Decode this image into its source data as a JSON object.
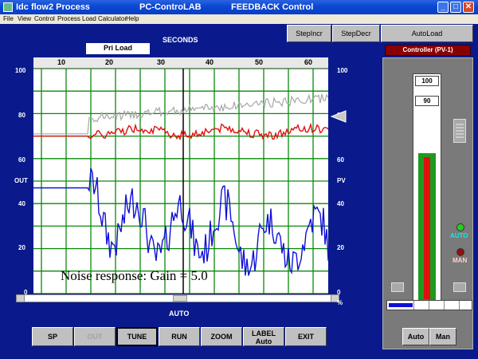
{
  "window": {
    "title_left": "Idc flow2 Process",
    "title_mid": "PC-ControLAB",
    "title_right": "FEEDBACK Control",
    "minimize": "_",
    "maximize": "□",
    "close": "✕"
  },
  "menu": [
    "File",
    "View",
    "Control",
    "Process",
    "Load",
    "Calculator",
    "Help"
  ],
  "header": {
    "seconds_label": "SECONDS",
    "load_label": "Pri Load",
    "step_incr": "StepIncr",
    "step_decr": "StepDecr",
    "auto_load": "AutoLoad",
    "controller_title": "Controller  (PV-1)"
  },
  "plot": {
    "time_ticks": [
      "10",
      "20",
      "30",
      "40",
      "50",
      "60"
    ],
    "left_scale": [
      "100",
      "80",
      "60",
      "40",
      "20",
      "0"
    ],
    "right_scale": [
      "100",
      "80",
      "60",
      "40",
      "20",
      "0"
    ],
    "out_label": "OUT",
    "pv_label": "PV",
    "annotation": "Noise response: Gain = 5.0",
    "percent_sign": "%",
    "mode_label": "AUTO",
    "colors": {
      "out": "#1010d8",
      "pv": "#e01010",
      "sp": "#a8a8a8",
      "grid": "#0a8a0a"
    }
  },
  "controls": {
    "sp": "SP",
    "out": "OUT",
    "tune": "TUNE",
    "run": "RUN",
    "zoom": "ZOOM",
    "label_top": "LABEL",
    "label_bottom": "Auto",
    "exit": "EXIT"
  },
  "controller": {
    "setpoint_readout": "100",
    "pv_readout": "90",
    "auto_text": "AUTO",
    "man_text": "MAN",
    "auto_button": "Auto",
    "man_button": "Man",
    "indicator_colors": {
      "auto": "#20d020",
      "man": "#901010"
    },
    "bar_outer_fraction": 0.84,
    "bar_inner_fraction": 0.8
  }
}
